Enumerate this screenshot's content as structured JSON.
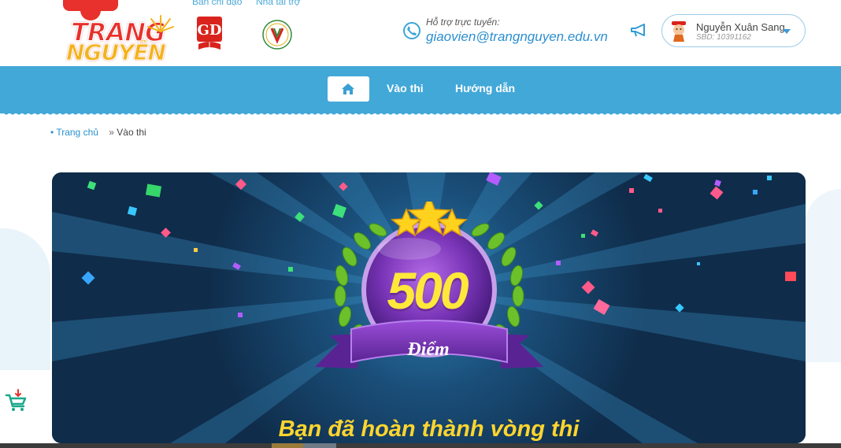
{
  "header": {
    "logo": {
      "line1": "TRANG",
      "line2": "NGUYÊN"
    },
    "partners": [
      {
        "label": "Ban chỉ đạo",
        "icon": "gd-ministry-logo"
      },
      {
        "label": "Nhà tài trợ",
        "icon": "viettel-sponsor-logo"
      }
    ],
    "support": {
      "label": "Hỗ trợ trực tuyến:",
      "email": "giaovien@trangnguyen.edu.vn",
      "icon": "phone-icon"
    },
    "announce_icon": "megaphone-icon",
    "user": {
      "name": "Nguyễn Xuân Sang",
      "sbd": "SBD: 10391162",
      "avatar": "mascot-avatar"
    }
  },
  "nav": {
    "home_icon": "home-icon",
    "items": [
      {
        "label": "Vào thi"
      },
      {
        "label": "Hướng dẫn"
      }
    ]
  },
  "breadcrumb": {
    "home": "Trang chủ",
    "separator": "»",
    "current": "Vào thi"
  },
  "result": {
    "score": "500",
    "unit": "Điểm",
    "message": "Bạn đã hoàn thành vòng thi",
    "star_count": 3
  },
  "floating": {
    "cart_icon": "cart-download-icon"
  },
  "colors": {
    "brand_blue": "#42a8d8",
    "link_blue": "#2a90cf",
    "panel_bg": "#123555",
    "score_yellow": "#ffe83a",
    "badge_purple": "#7a35b8",
    "laurel_green": "#6cc02a",
    "logo_red": "#e8312c",
    "logo_yellow": "#f3b31a"
  }
}
